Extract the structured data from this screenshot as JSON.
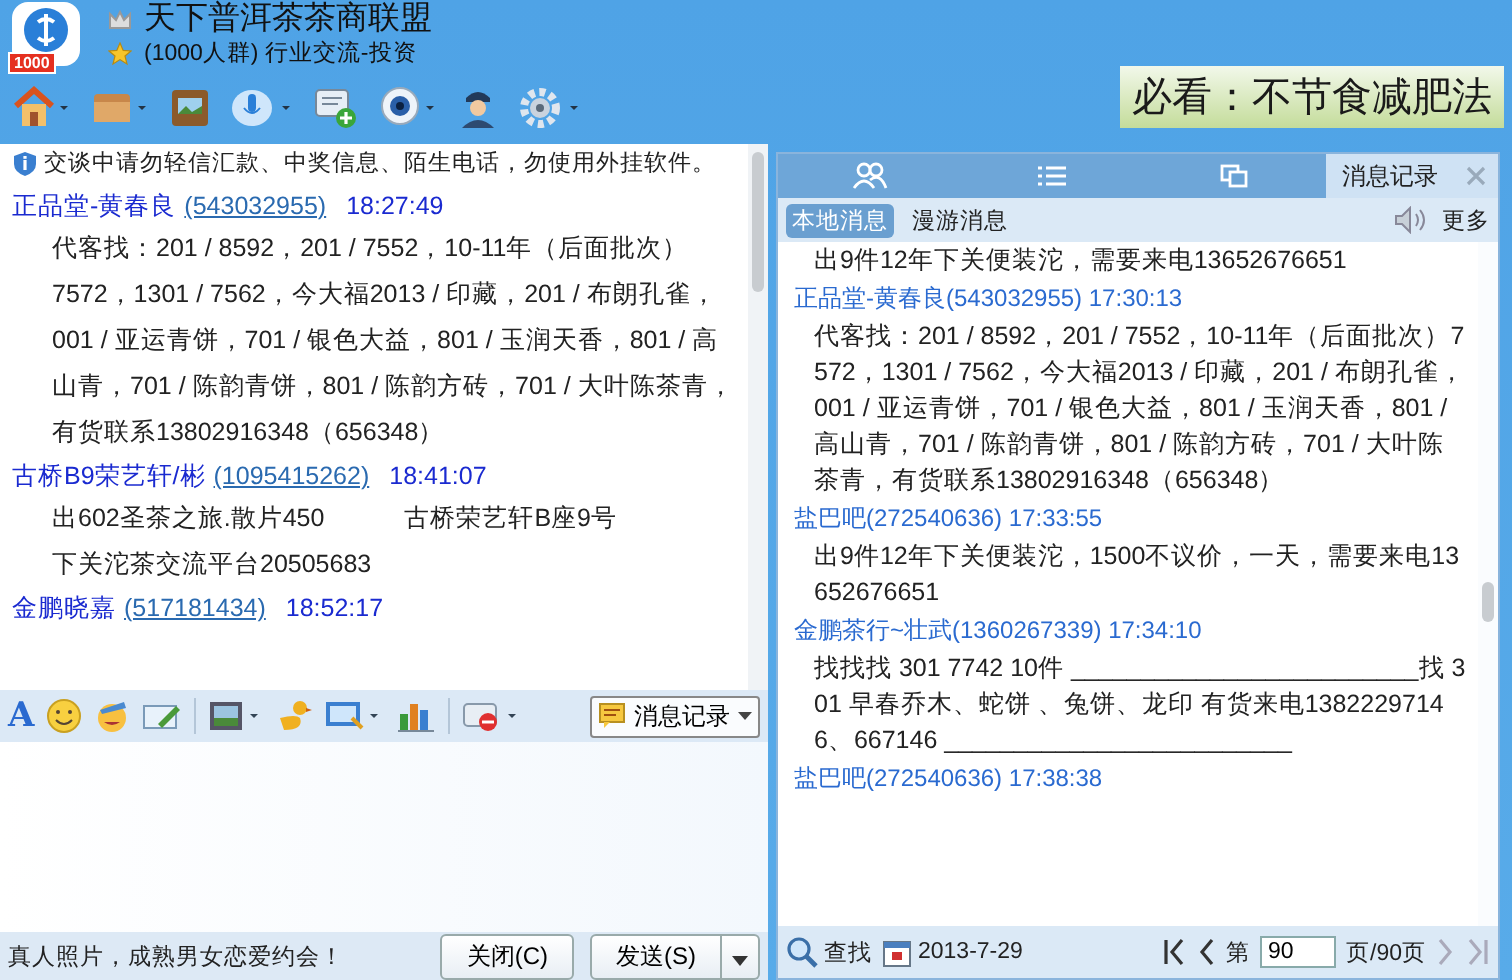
{
  "group": {
    "badge": "1000",
    "title": "天下普洱茶茶商联盟",
    "subtitle": "(1000人群) 行业交流-投资"
  },
  "ad_banner": "必看：不节食减肥法",
  "notice": "交谈中请勿轻信汇款、中奖信息、陌生电话，勿使用外挂软件。",
  "chat": [
    {
      "sender": "正品堂-黄春良",
      "id": "(543032955)",
      "time": "18:27:49",
      "lines": [
        [
          "代客找：201 / 8592，201 / 7552，10-11年（后面批次）7572，1301 / 7562，今大福2013 / 印藏，201 / 布朗孔雀，001 / 亚运青饼，701 / 银色大益，801 / 玉润天香，801 / 高山青，701 / 陈韵青饼，801 / 陈韵方砖，701 / 大叶陈茶青，有货联系13802916348（656348）"
        ]
      ]
    },
    {
      "sender": "古桥B9荣艺轩/彬",
      "id": "(1095415262)",
      "time": "18:41:07",
      "lines": [
        [
          "出602圣茶之旅.散片450",
          "古桥荣艺轩B座9号"
        ],
        [
          "下关沱茶交流平台20505683"
        ]
      ]
    },
    {
      "sender": "金鹏晓嘉",
      "id": "(517181434)",
      "time": "18:52:17"
    }
  ],
  "input_toolbar": {
    "font_glyph": "A",
    "history_button": "消息记录"
  },
  "footer": {
    "ad_text": "真人照片，成熟男女恋爱约会！",
    "close_button": "关闭(C)",
    "send_button": "发送(S)"
  },
  "history": {
    "tabs": [
      {
        "kind": "contacts",
        "selected": false
      },
      {
        "kind": "list",
        "selected": false
      },
      {
        "kind": "windows",
        "selected": false
      },
      {
        "kind": "text",
        "label": "消息记录",
        "selected": true
      }
    ],
    "subtabs": [
      {
        "label": "本地消息",
        "selected": true
      },
      {
        "label": "漫游消息",
        "selected": false
      }
    ],
    "more": "更多",
    "messages": [
      {
        "kind": "text",
        "text": "出9件12年下关便装沱，需要来电13652676651"
      },
      {
        "kind": "header",
        "text": "正品堂-黄春良(543032955) 17:30:13"
      },
      {
        "kind": "text",
        "text": "代客找：201 / 8592，201 / 7552，10-11年（后面批次）7572，1301 / 7562，今大福2013 / 印藏，201 / 布朗孔雀，001 / 亚运青饼，701 / 银色大益，801 / 玉润天香，801 / 高山青，701 / 陈韵青饼，801 / 陈韵方砖，701 / 大叶陈茶青，有货联系13802916348（656348）"
      },
      {
        "kind": "header",
        "text": "盐巴吧(272540636) 17:33:55"
      },
      {
        "kind": "text",
        "text": "出9件12年下关便装沱，1500不议价，一天，需要来电13652676651"
      },
      {
        "kind": "header",
        "text": "金鹏茶行~壮武(1360267339) 17:34:10"
      },
      {
        "kind": "text",
        "text": "找找找 301 7742  10件   _________________________找 301 早春乔木、蛇饼 、兔饼、龙印 有货来电13822297146、667146 _________________________"
      },
      {
        "kind": "header",
        "text": "盐巴吧(272540636) 17:38:38"
      }
    ],
    "search": "查找",
    "date": "2013-7-29",
    "page_prefix": "第",
    "page": "90",
    "page_suffix": "页/90页"
  }
}
